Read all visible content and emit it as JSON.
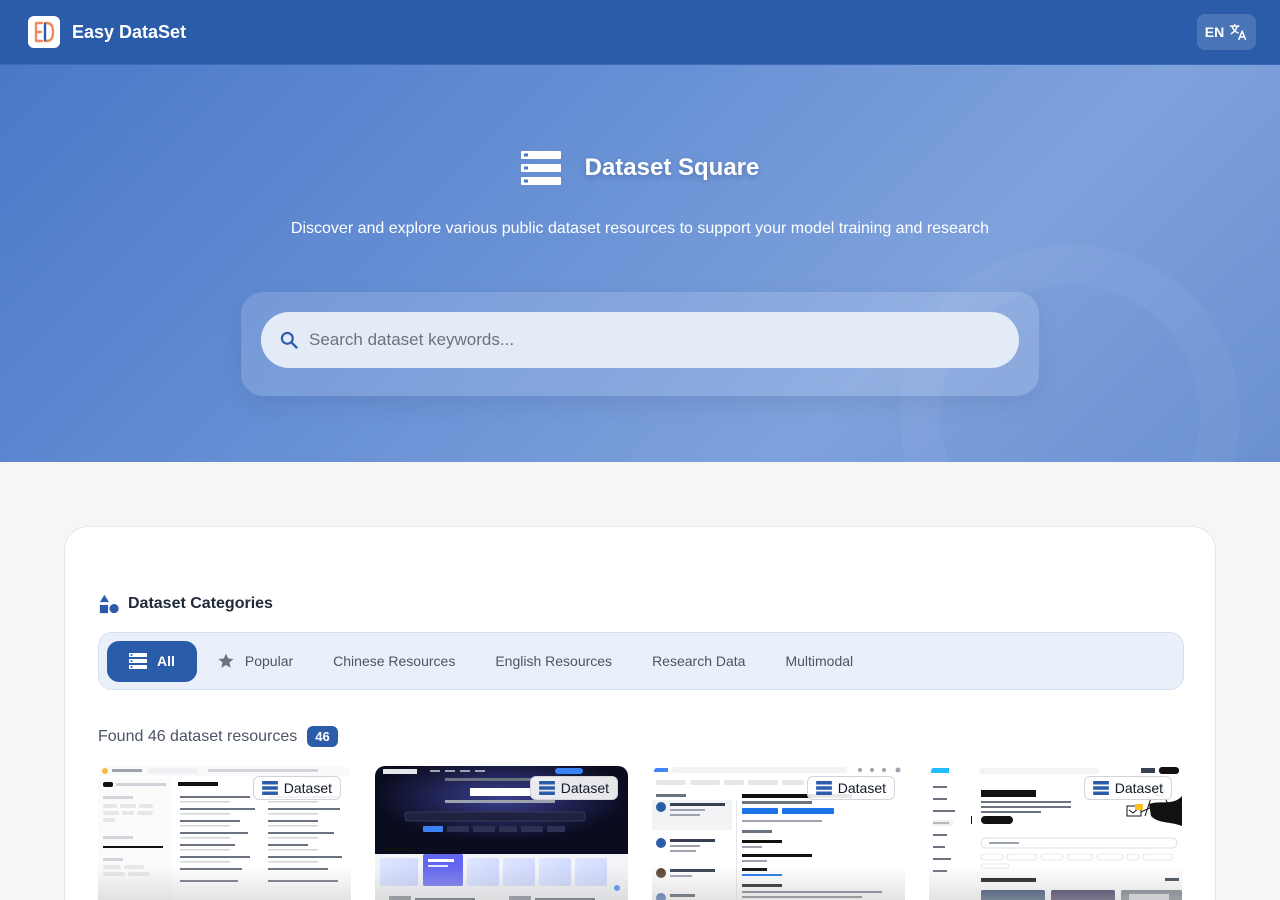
{
  "header": {
    "brand": "Easy DataSet",
    "lang_label": "EN",
    "accent_color": "#2a5caa"
  },
  "hero": {
    "title": "Dataset Square",
    "subtitle": "Discover and explore various public dataset resources to support your model training and research",
    "search_placeholder": "Search dataset keywords..."
  },
  "categories": {
    "title": "Dataset Categories",
    "tabs": [
      {
        "label": "All",
        "icon": "dataset-icon",
        "active": true
      },
      {
        "label": "Popular",
        "icon": "star-icon",
        "active": false
      },
      {
        "label": "Chinese Resources",
        "active": false
      },
      {
        "label": "English Resources",
        "active": false
      },
      {
        "label": "Research Data",
        "active": false
      },
      {
        "label": "Multimodal",
        "active": false
      }
    ]
  },
  "results": {
    "found_text": "Found 46 dataset resources",
    "count": "46"
  },
  "cards": [
    {
      "tag": "Dataset",
      "thumb": "hugging-face-screenshot"
    },
    {
      "tag": "Dataset",
      "thumb": "opendatalab-screenshot"
    },
    {
      "tag": "Dataset",
      "thumb": "google-search-screenshot"
    },
    {
      "tag": "Dataset",
      "thumb": "kaggle-screenshot"
    }
  ]
}
